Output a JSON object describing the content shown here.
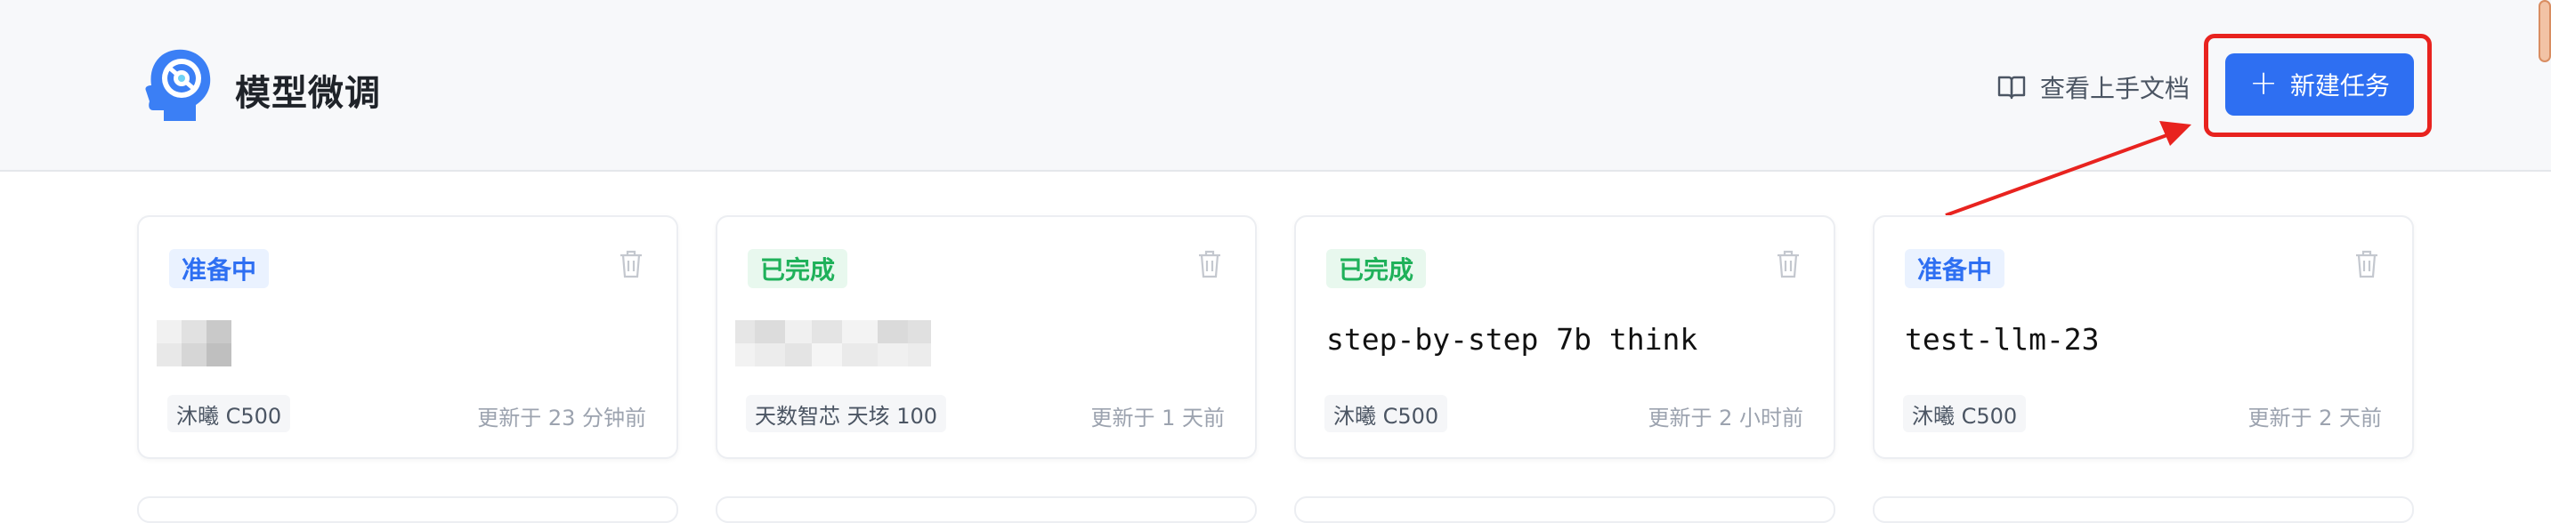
{
  "header": {
    "title": "模型微调",
    "docs_link": "查看上手文档",
    "new_task_button": "新建任务"
  },
  "colors": {
    "accent": "#2e6ff2",
    "preparing": "#2e6ff2",
    "done": "#1fb15a",
    "annotation": "#e8231f"
  },
  "tasks": [
    {
      "status": "准备中",
      "status_kind": "preparing",
      "name": "",
      "name_redacted": true,
      "device": "沐曦 C500",
      "updated": "更新于 23 分钟前"
    },
    {
      "status": "已完成",
      "status_kind": "done",
      "name": "",
      "name_redacted": true,
      "device": "天数智芯 天垓 100",
      "updated": "更新于 1 天前"
    },
    {
      "status": "已完成",
      "status_kind": "done",
      "name": "step-by-step 7b think",
      "name_redacted": false,
      "device": "沐曦 C500",
      "updated": "更新于 2 小时前"
    },
    {
      "status": "准备中",
      "status_kind": "preparing",
      "name": "test-llm-23",
      "name_redacted": false,
      "device": "沐曦 C500",
      "updated": "更新于 2 天前"
    }
  ],
  "icons": {
    "logo": "head-logo-icon",
    "docs": "book-icon",
    "delete": "trash-icon",
    "add": "plus-icon"
  }
}
